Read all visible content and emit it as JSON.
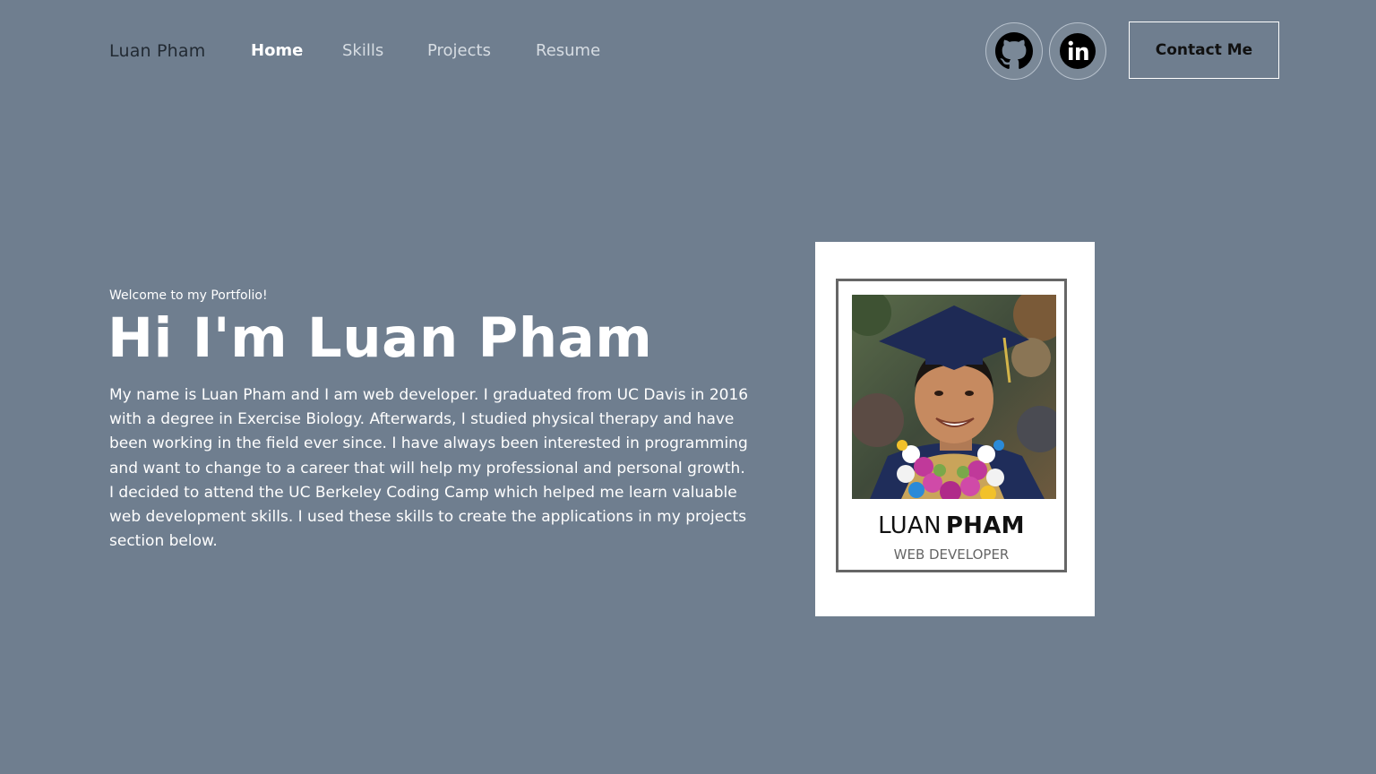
{
  "nav": {
    "brand": "Luan Pham",
    "links": [
      {
        "label": "Home",
        "active": true
      },
      {
        "label": "Skills",
        "active": false
      },
      {
        "label": "Projects",
        "active": false
      },
      {
        "label": "Resume",
        "active": false
      }
    ],
    "social": [
      {
        "icon": "github-icon"
      },
      {
        "icon": "linkedin-icon"
      }
    ],
    "contact_label": "Contact Me"
  },
  "hero": {
    "welcome": "Welcome to my Portfolio!",
    "headline": "Hi I'm Luan Pham",
    "bio": "My name is Luan Pham and I am web developer. I graduated from UC Davis in 2016 with a degree in Exercise Biology. Afterwards, I studied physical therapy and have been working in the field ever since. I have always been interested in programming and want to change to a career that will help my professional and personal growth. I decided to attend the UC Berkeley Coding Camp which helped me learn valuable web development skills. I used these skills to create the applications in my projects section below."
  },
  "card": {
    "first_name": "LUAN",
    "last_name": "PHAM",
    "role": "WEB DEVELOPER"
  },
  "colors": {
    "background": "#6f7e8f",
    "card": "#ffffff",
    "frame": "#666666"
  }
}
